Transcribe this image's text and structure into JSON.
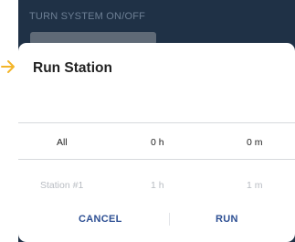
{
  "background": {
    "label": "TURN SYSTEM ON/OFF"
  },
  "dialog": {
    "title": "Run Station",
    "rows": [
      {
        "name": "All",
        "hours": "0 h",
        "minutes": "0 m"
      },
      {
        "name": "Station #1",
        "hours": "1 h",
        "minutes": "1 m"
      }
    ],
    "cancel_label": "CANCEL",
    "run_label": "RUN"
  },
  "colors": {
    "accent": "#2d4f93",
    "backdrop": "#1f3146",
    "pointer_arrow": "#f3b52a"
  }
}
